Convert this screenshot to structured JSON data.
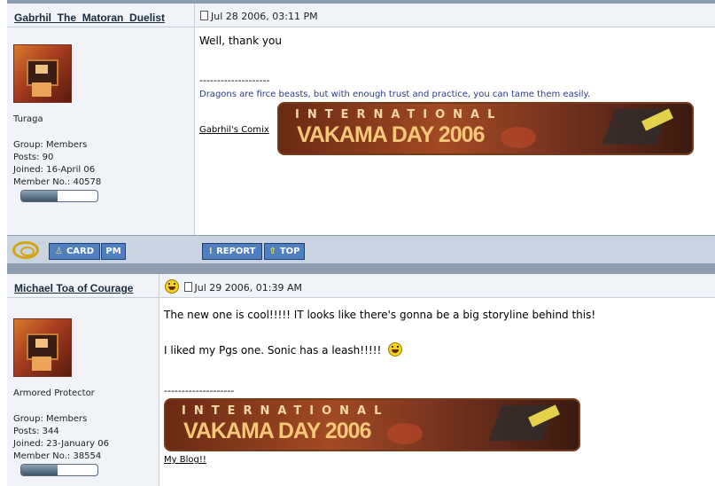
{
  "posts": [
    {
      "author": "Gabrhil_The_Matoran_Duelist",
      "date": "Jul 28 2006, 03:11 PM",
      "title": "Turaga",
      "group": "Group: Members",
      "posts": "Posts: 90",
      "joined": "Joined: 16-April 06",
      "member_no": "Member No.: 40578",
      "body": [
        "Well, thank you"
      ],
      "sig_divider": "--------------------",
      "sig_quote": "Dragons are firce beasts, but with enough trust and practice, you can tame them easily.",
      "sig_link": "Gabrhil's Comix",
      "banner_top": "INTERNATIONAL",
      "banner_main": "VAKAMA DAY 2006"
    },
    {
      "author": "Michael Toa of Courage",
      "date": "Jul 29 2006, 01:39 AM",
      "title": "Armored Protector",
      "group": "Group: Members",
      "posts": "Posts: 344",
      "joined": "Joined: 23-January 06",
      "member_no": "Member No.: 38554",
      "body": [
        "The new one is cool!!!!! IT looks like there's gonna be a big storyline behind this!",
        "I liked my Pgs one. Sonic has a leash!!!!!"
      ],
      "sig_divider": "--------------------",
      "sig_link": "My Blog!!",
      "banner_top": "INTERNATIONAL",
      "banner_main": "VAKAMA DAY 2006"
    }
  ],
  "buttons": {
    "card": "CARD",
    "pm": "PM",
    "report": "REPORT",
    "top": "TOP"
  },
  "icons": [
    "document-icon",
    "online-status-icon",
    "laughing-smiley-icon",
    "person-icon",
    "exclamation-icon",
    "up-arrow-icon"
  ],
  "colors": {
    "header_bg": "#f0f3f7",
    "separator": "#8b9dae",
    "button": "#4f7fbf",
    "signature_text": "#2a3c8c"
  }
}
